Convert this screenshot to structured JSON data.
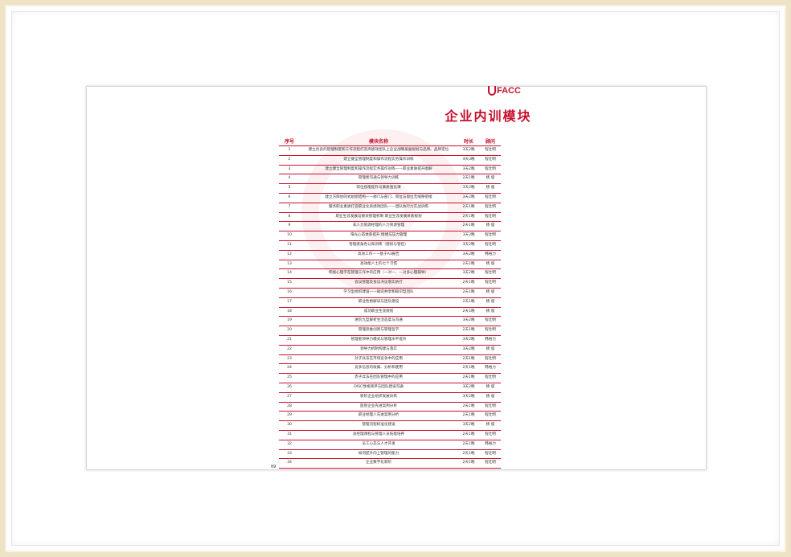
{
  "logo_text": "FACC",
  "title": "企业内训模块",
  "page_number": "69",
  "table": {
    "headers": [
      "序号",
      "模块名称",
      "时长",
      "顾问"
    ],
    "rows": [
      [
        "1",
        "建立优良的管理制度和工作流程打造高绩效团队上企业战略发展规划与品牌、品牌定位",
        "3天2晚",
        "程壮明"
      ],
      [
        "2",
        "建立健全管理制度和操作流程实务操作训练",
        "4天3晚",
        "程壮明"
      ],
      [
        "3",
        "建立健全管理制度和操作流程实务操作训练——职业素质提升图解",
        "3天2晚",
        "程壮明"
      ],
      [
        "4",
        "管理者沟通与领导力训练",
        "2天1晚",
        "杨 俊"
      ],
      [
        "5",
        "岗位技能提升与素质强化课",
        "3天2晚",
        "杨 俊"
      ],
      [
        "6",
        "建立方阵协同式组织结构——部门与部门、岗位与岗位无缝隙衔接",
        "3天2晚",
        "程壮明"
      ],
      [
        "7",
        "服务职业素质打造职业化高绩效团队——团队执行力实战训练",
        "2天1晚",
        "程壮明"
      ],
      [
        "8",
        "职业生涯发展与绩效管理机制    职业生涯发展体系规划",
        "2天1晚",
        "程壮明"
      ],
      [
        "9",
        "非人力资源经理的人力资源管理",
        "2天1晚",
        "杨 俊"
      ],
      [
        "10",
        "阳光心态体系提升 情绪与压力管理",
        "3天2晚",
        "程壮明"
      ],
      [
        "11",
        "管理者角色认知训练（授权与管控）",
        "3天2晚",
        "程壮明"
      ],
      [
        "12",
        "高效工作——基于A3报告",
        "3天2晚",
        "韩裕力"
      ],
      [
        "13",
        "高效能人士的七个习惯",
        "2天1晚",
        "杨 俊"
      ],
      [
        "14",
        "积极心理学在管理工作中的应用（一对一、一对多心理辅导）",
        "3天2晚",
        "程壮明"
      ],
      [
        "15",
        "会议管理及会议决议落实执行",
        "2天1晚",
        "程壮明"
      ],
      [
        "16",
        "学习型组织建设——知识共享和知识型团队",
        "2天1晚",
        "杨 俊"
      ],
      [
        "17",
        "职业性格解读与团队建设",
        "2天1晚",
        "杨 俊"
      ],
      [
        "18",
        "成功职业生涯规划",
        "2天1晚",
        "杨 俊"
      ],
      [
        "19",
        "进阶九型解析生活态度与沟通",
        "3天2晚",
        "程壮明"
      ],
      [
        "20",
        "管理思维创新与管理哲学",
        "2天1晚",
        "程壮明"
      ],
      [
        "21",
        "管理者领导力模式与管理水平提升",
        "3天2晚",
        "韩裕力"
      ],
      [
        "22",
        "领导力机制构建与落实",
        "3天2晚",
        "杨 俊"
      ],
      [
        "23",
        "孙子兵法在市场竞争中的应用",
        "2天1晚",
        "程壮明"
      ],
      [
        "24",
        "竞争信息的收集、分析和使用",
        "2天1晚",
        "韩裕力"
      ],
      [
        "25",
        "赤子兵法在团队管理中的应用",
        "2天1晚",
        "程壮明"
      ],
      [
        "26",
        "DISC性格测评与团队建设沟通",
        "3天2晚",
        "杨 俊"
      ],
      [
        "27",
        "新阶企业组织发展训练",
        "3天2晚",
        "杨 俊"
      ],
      [
        "28",
        "医管企业先进案例分析",
        "2天1晚",
        "程壮明"
      ],
      [
        "29",
        "职业经理人先进案例分析",
        "2天1晚",
        "程壮明"
      ],
      [
        "30",
        "管理流程标准化建设",
        "3天2晚",
        "杨 俊"
      ],
      [
        "31",
        "总经理课程与管理人员技能培养",
        "2天1晚",
        "程壮明"
      ],
      [
        "32",
        "员工心态与人才开发",
        "2天1晚",
        "韩裕力"
      ],
      [
        "33",
        "如何提升向上管理的能力",
        "2天1晚",
        "程壮明"
      ],
      [
        "34",
        "企业数字化新阶",
        "2天1晚",
        "程壮明"
      ]
    ]
  }
}
